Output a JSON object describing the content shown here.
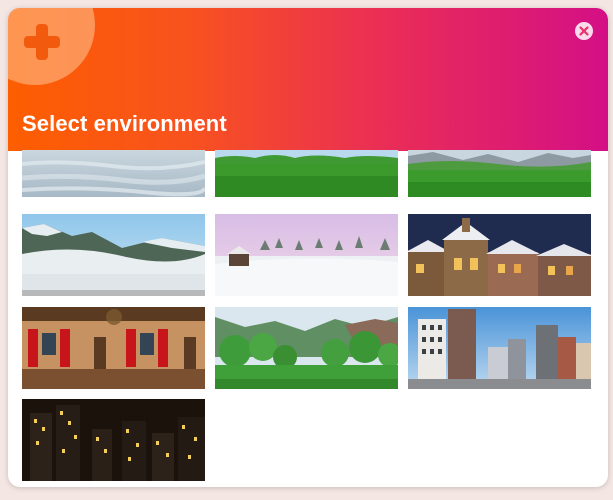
{
  "dialog": {
    "title": "Select environment",
    "header_icon": "plus-icon",
    "close_icon": "close-icon",
    "colors": {
      "gradient_start": "#fd5e00",
      "gradient_end": "#d40f86",
      "title_text": "#ffffff"
    }
  },
  "environments": [
    {
      "name": "snowy-plain",
      "icon": "environment-thumbnail"
    },
    {
      "name": "green-field",
      "icon": "environment-thumbnail"
    },
    {
      "name": "mountain-meadow",
      "icon": "environment-thumbnail"
    },
    {
      "name": "snowy-mountains",
      "icon": "environment-thumbnail"
    },
    {
      "name": "winter-cabin",
      "icon": "environment-thumbnail"
    },
    {
      "name": "winter-village-night",
      "icon": "environment-thumbnail"
    },
    {
      "name": "wooden-hall",
      "icon": "environment-thumbnail"
    },
    {
      "name": "green-valley",
      "icon": "environment-thumbnail"
    },
    {
      "name": "city-day",
      "icon": "environment-thumbnail"
    },
    {
      "name": "city-night",
      "icon": "environment-thumbnail"
    }
  ]
}
